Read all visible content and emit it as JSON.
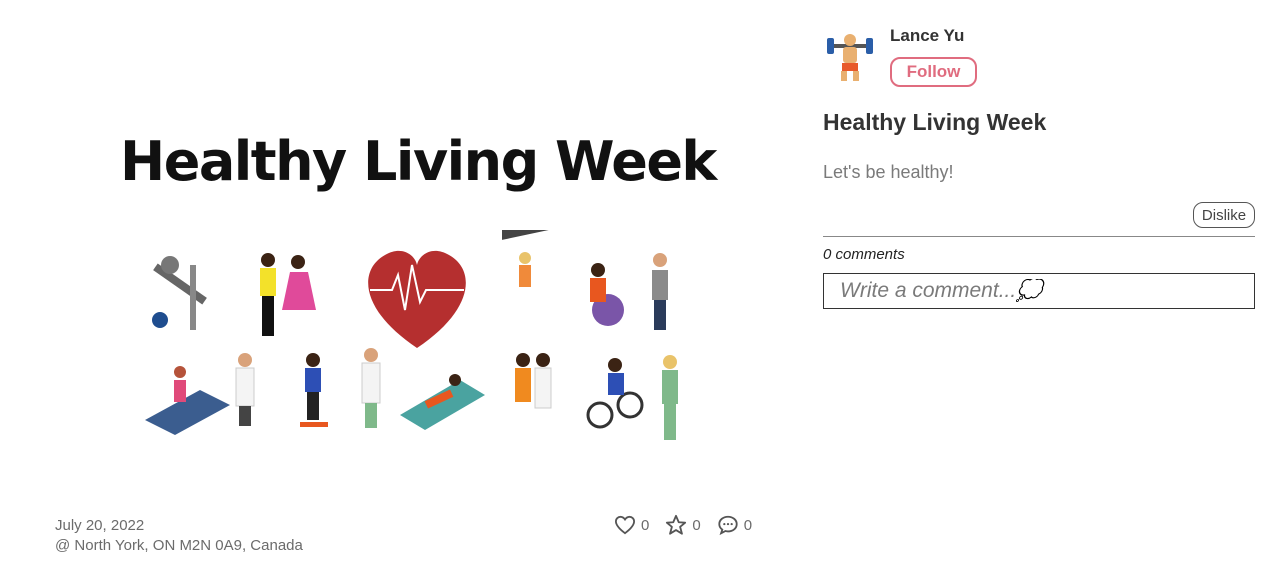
{
  "post": {
    "image_headline": "Healthy Living Week",
    "date": "July 20, 2022",
    "location": "@ North York, ON M2N 0A9, Canada",
    "likes": "0",
    "stars": "0",
    "comment_count_stat": "0"
  },
  "author": {
    "name": "Lance Yu",
    "follow_label": "Follow"
  },
  "details": {
    "title": "Healthy Living Week",
    "body": "Let's be healthy!",
    "dislike_label": "Dislike",
    "comments_label": "0 comments",
    "comment_placeholder": "Write a comment...💭"
  },
  "icons": {
    "like": "heart-icon",
    "star": "star-icon",
    "comment": "comment-icon"
  },
  "colors": {
    "accent": "#e06c7f",
    "heart": "#b52f2f"
  }
}
